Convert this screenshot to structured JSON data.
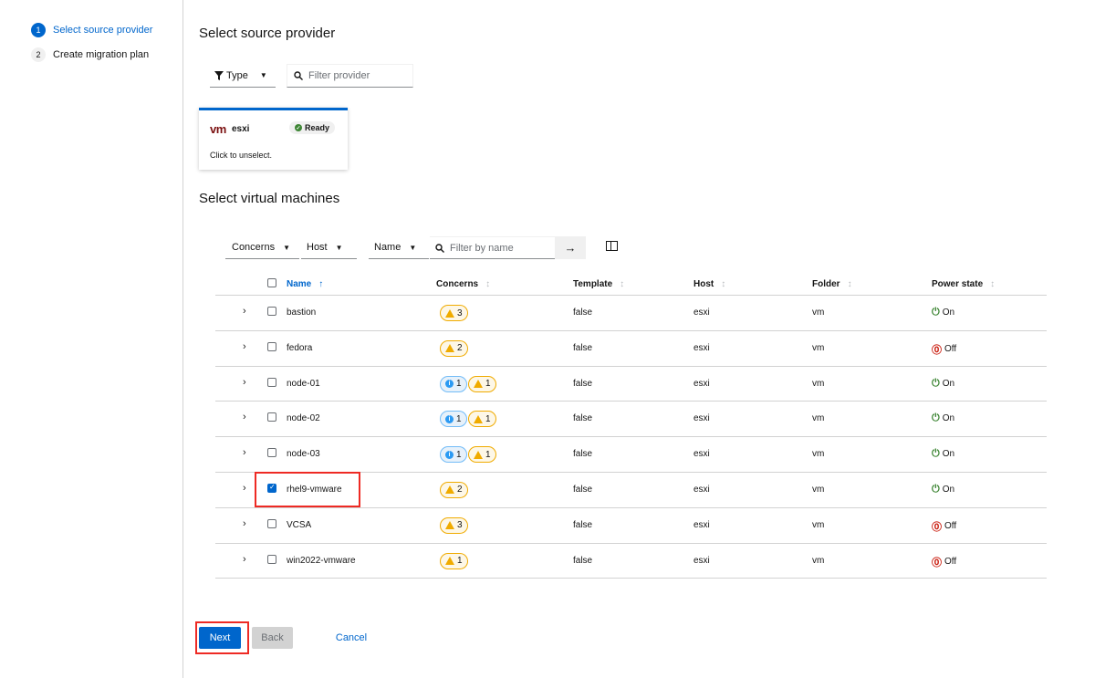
{
  "wizard": {
    "steps": [
      {
        "number": "1",
        "label": "Select source provider"
      },
      {
        "number": "2",
        "label": "Create migration plan"
      }
    ]
  },
  "source_section": {
    "title": "Select source provider",
    "type_filter_label": "Type",
    "filter_placeholder": "Filter provider"
  },
  "provider_card": {
    "logo_text": "vm",
    "name": "esxi",
    "status": "Ready",
    "hint": "Click to unselect."
  },
  "vm_section": {
    "title": "Select virtual machines",
    "toolbar": {
      "concerns_label": "Concerns",
      "host_label": "Host",
      "name_label": "Name",
      "filter_placeholder": "Filter by name",
      "arrow": "→"
    },
    "columns": [
      "Name",
      "Concerns",
      "Template",
      "Host",
      "Folder",
      "Power state"
    ],
    "sort_asc_glyph": "↑",
    "sort_glyph": "↕",
    "rows": [
      {
        "name": "bastion",
        "info": "",
        "warn": "3",
        "template": "false",
        "host": "esxi",
        "folder": "vm",
        "power": "On",
        "checked": false
      },
      {
        "name": "fedora",
        "info": "",
        "warn": "2",
        "template": "false",
        "host": "esxi",
        "folder": "vm",
        "power": "Off",
        "checked": false
      },
      {
        "name": "node-01",
        "info": "1",
        "warn": "1",
        "template": "false",
        "host": "esxi",
        "folder": "vm",
        "power": "On",
        "checked": false
      },
      {
        "name": "node-02",
        "info": "1",
        "warn": "1",
        "template": "false",
        "host": "esxi",
        "folder": "vm",
        "power": "On",
        "checked": false
      },
      {
        "name": "node-03",
        "info": "1",
        "warn": "1",
        "template": "false",
        "host": "esxi",
        "folder": "vm",
        "power": "On",
        "checked": false
      },
      {
        "name": "rhel9-vmware",
        "info": "",
        "warn": "2",
        "template": "false",
        "host": "esxi",
        "folder": "vm",
        "power": "On",
        "checked": true
      },
      {
        "name": "VCSA",
        "info": "",
        "warn": "3",
        "template": "false",
        "host": "esxi",
        "folder": "vm",
        "power": "Off",
        "checked": false
      },
      {
        "name": "win2022-vmware",
        "info": "",
        "warn": "1",
        "template": "false",
        "host": "esxi",
        "folder": "vm",
        "power": "Off",
        "checked": false
      }
    ]
  },
  "footer": {
    "next_label": "Next",
    "back_label": "Back",
    "cancel_label": "Cancel"
  },
  "colors": {
    "accent": "#0066cc",
    "power_on": "#3e8635",
    "power_off": "#c9190b",
    "warning": "#f0ab00",
    "info": "#2b9af3",
    "highlight": "#ee2a24"
  }
}
